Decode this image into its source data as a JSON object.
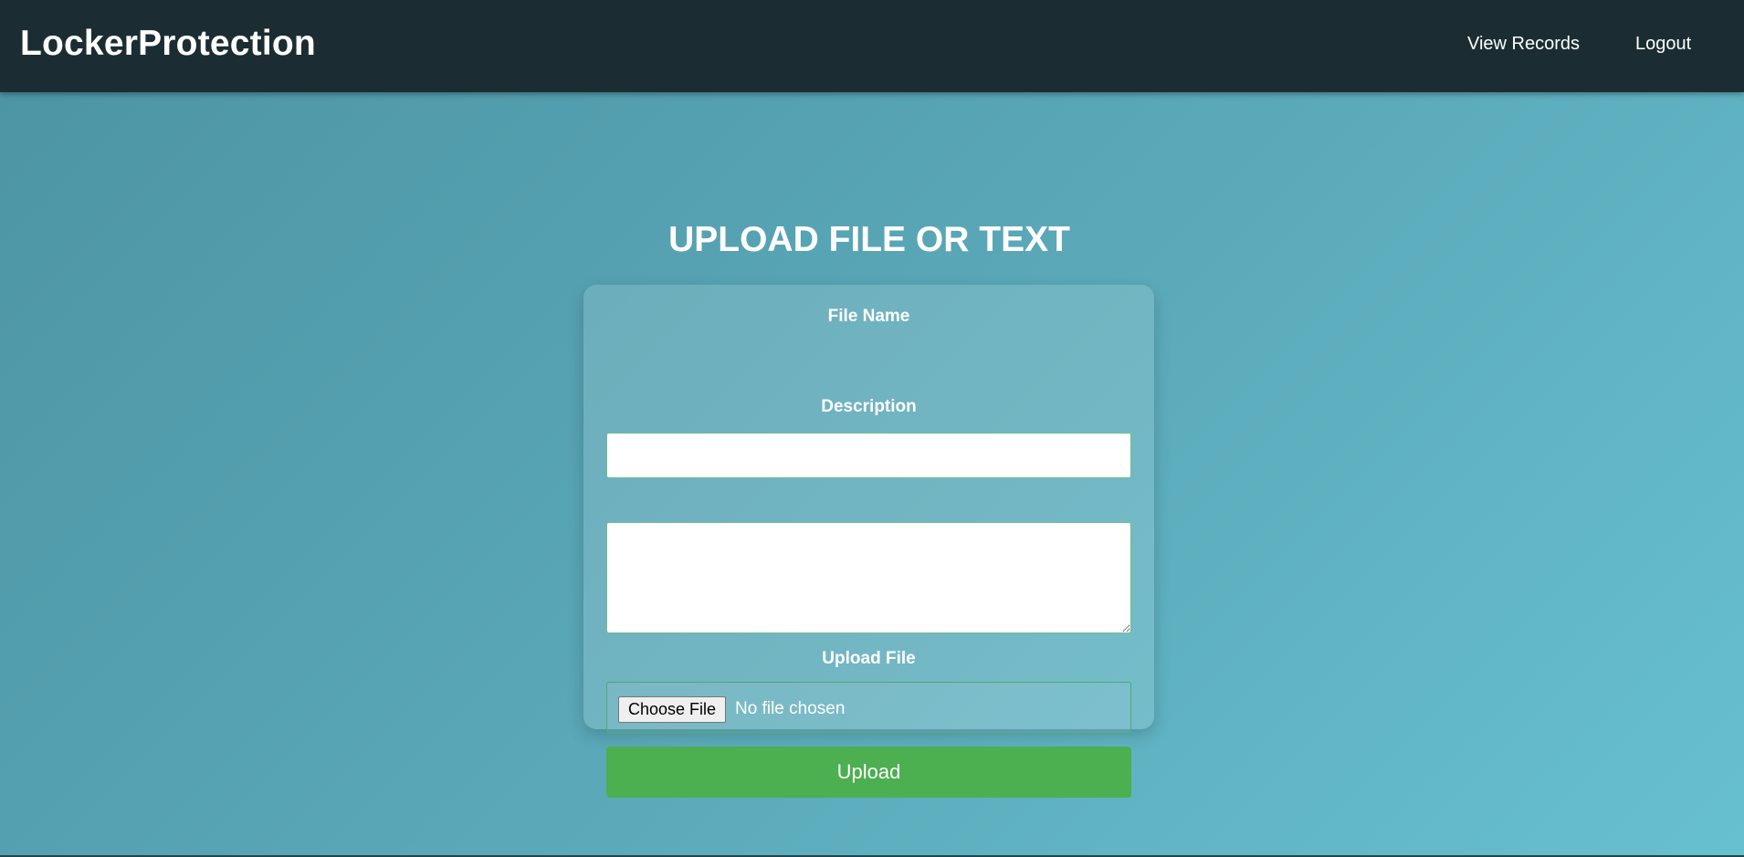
{
  "navbar": {
    "brand": "LockerProtection",
    "links": [
      {
        "label": "View Records"
      },
      {
        "label": "Logout"
      }
    ]
  },
  "upload_form": {
    "title": "UPLOAD FILE OR TEXT",
    "file_name": {
      "label": "File Name",
      "value": "",
      "placeholder": ""
    },
    "description": {
      "label": "Description",
      "value": "",
      "placeholder": ""
    },
    "upload_file": {
      "label": "Upload File",
      "choose_button": "Choose File",
      "status": "No file chosen"
    },
    "submit_label": "Upload"
  },
  "colors": {
    "navbar_bg": "#1b2d33",
    "gradient_start": "#4d95a5",
    "gradient_end": "#67c0cf",
    "upload_button": "#4caf50",
    "text": "#ffffff"
  }
}
